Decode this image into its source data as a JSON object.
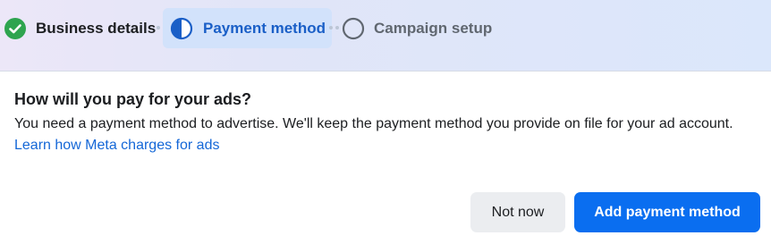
{
  "stepper": {
    "steps": [
      {
        "label": "Business details",
        "status": "completed"
      },
      {
        "label": "Payment method",
        "status": "in-progress"
      },
      {
        "label": "Campaign setup",
        "status": "pending"
      }
    ]
  },
  "main": {
    "title": "How will you pay for your ads?",
    "description": "You need a payment method to advertise. We'll keep the payment method you provide on file for your ad account. ",
    "link_text": "Learn how Meta charges for ads"
  },
  "actions": {
    "secondary_label": "Not now",
    "primary_label": "Add payment method"
  },
  "colors": {
    "success": "#2ea44f",
    "accent": "#0a6ef0",
    "active_text": "#1a5fc7",
    "pending": "#606770"
  },
  "icons": {
    "step1": "check-circle-icon",
    "step2": "half-circle-icon",
    "step3": "empty-circle-icon"
  }
}
